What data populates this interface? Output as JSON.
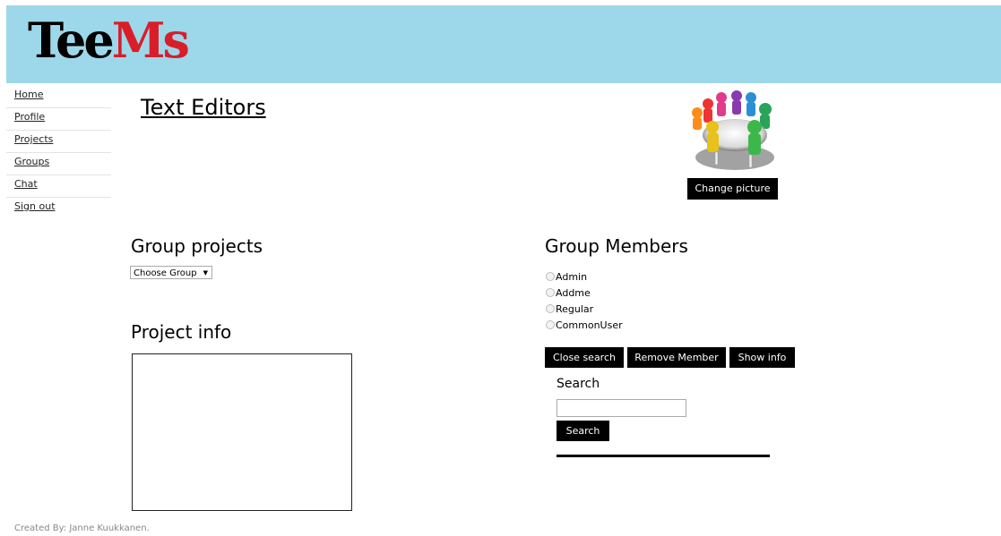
{
  "header": {
    "logo_part1": "Tee",
    "logo_part2": "Ms",
    "bg_color": "#9dd8ea",
    "logo_accent": "#d91e2a"
  },
  "nav": {
    "items": [
      {
        "label": "Home"
      },
      {
        "label": "Profile"
      },
      {
        "label": "Projects"
      },
      {
        "label": "Groups"
      },
      {
        "label": "Chat"
      },
      {
        "label": "Sign out"
      }
    ]
  },
  "page": {
    "title": "Text Editors"
  },
  "group_picture": {
    "icon": "group-meeting-icon",
    "button_label": "Change picture"
  },
  "group_projects": {
    "title": "Group projects",
    "select_value": "Choose Group"
  },
  "project_info": {
    "title": "Project info"
  },
  "group_members": {
    "title": "Group Members",
    "members": [
      {
        "name": "Admin"
      },
      {
        "name": "Addme"
      },
      {
        "name": "Regular"
      },
      {
        "name": "CommonUser"
      }
    ],
    "buttons": {
      "close_search": "Close search",
      "remove_member": "Remove Member",
      "show_info": "Show info"
    }
  },
  "search": {
    "label": "Search",
    "value": "",
    "button_label": "Search"
  },
  "footer": {
    "text": "Created By: Janne Kuukkanen."
  }
}
